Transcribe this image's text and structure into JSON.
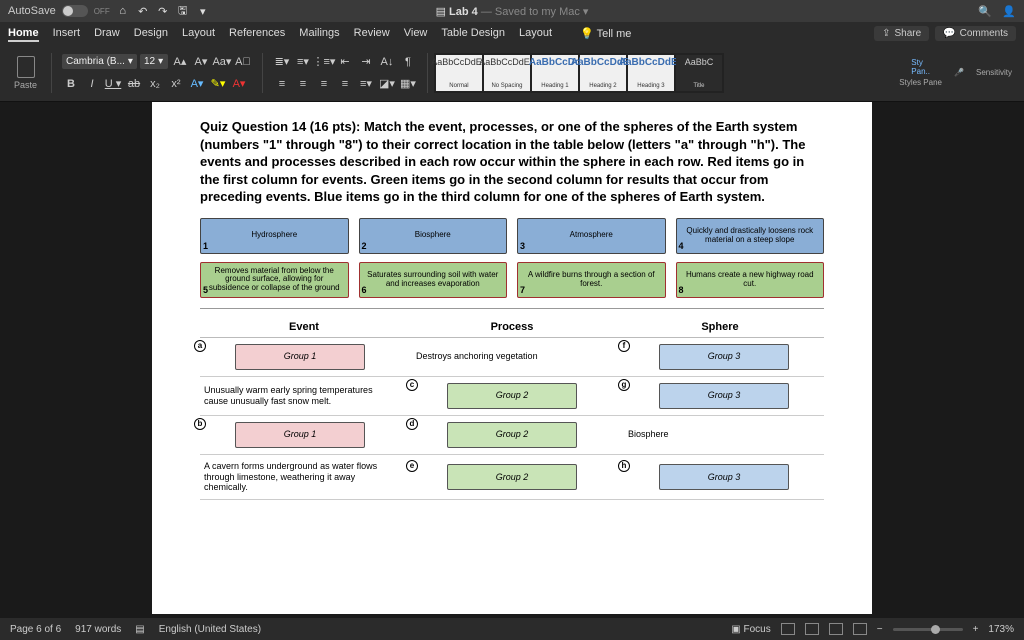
{
  "titlebar": {
    "autosave_label": "AutoSave",
    "autosave_state": "OFF",
    "doc_title": "Lab 4",
    "doc_status": "Saved to my Mac"
  },
  "menus": [
    "Home",
    "Insert",
    "Draw",
    "Design",
    "Layout",
    "References",
    "Mailings",
    "Review",
    "View",
    "Table Design",
    "Layout"
  ],
  "tellme": "Tell me",
  "share": "Share",
  "comments": "Comments",
  "ribbon": {
    "paste": "Paste",
    "font_name": "Cambria (B...",
    "font_size": "12",
    "styles": [
      {
        "preview": "AaBbCcDdEe",
        "name": "Normal"
      },
      {
        "preview": "AaBbCcDdEe",
        "name": "No Spacing"
      },
      {
        "preview": "AaBbCcDd",
        "name": "Heading 1",
        "blue": true
      },
      {
        "preview": "AaBbCcDdEe",
        "name": "Heading 2",
        "blue": true
      },
      {
        "preview": "AaBbCcDdEe",
        "name": "Heading 3",
        "blue": true
      },
      {
        "preview": "AaBbC",
        "name": "Title",
        "dark": true
      }
    ],
    "styles_pane": "Styles Pane",
    "sensitivity": "Sensitivity",
    "dictate": "Dictate"
  },
  "doc": {
    "heading_bold": "Quiz Question 14 (16 pts): ",
    "heading_rest": "Match the event, processes, or one of the spheres of the Earth system (numbers \"1\" through \"8\") to their correct location in the table below (letters \"a\" through \"h\"). The events and processes described in each row occur within the sphere in each row. Red items go in the first column for events. Green items go in the second column for results that occur from preceding events. Blue items go in the third column for one of the spheres of Earth system.",
    "cards_blue": [
      {
        "n": "1",
        "t": "Hydrosphere"
      },
      {
        "n": "2",
        "t": "Biosphere"
      },
      {
        "n": "3",
        "t": "Atmosphere"
      },
      {
        "n": "4",
        "t": "Quickly and drastically loosens rock material on a steep slope"
      }
    ],
    "cards_green": [
      {
        "n": "5",
        "t": "Removes material from below the ground surface, allowing for subsidence or collapse of the ground"
      },
      {
        "n": "6",
        "t": "Saturates surrounding soil with water and increases evaporation"
      },
      {
        "n": "7",
        "t": "A wildfire burns through a section of forest."
      },
      {
        "n": "8",
        "t": "Humans create a new highway road cut."
      }
    ],
    "th": [
      "Event",
      "Process",
      "Sphere"
    ],
    "rows": [
      {
        "a": "a",
        "at": "drop-pink",
        "av": "Group 1",
        "b": null,
        "bt": "text",
        "bv": "Destroys anchoring vegetation",
        "c": "f",
        "ct": "drop-blu",
        "cv": "Group 3"
      },
      {
        "a": null,
        "at": "text",
        "av": "Unusually warm early spring temperatures cause unusually fast snow melt.",
        "b": "c",
        "bt": "drop-grn",
        "bv": "Group 2",
        "c": "g",
        "ct": "drop-blu",
        "cv": "Group 3"
      },
      {
        "a": "b",
        "at": "drop-pink",
        "av": "Group 1",
        "b": "d",
        "bt": "drop-grn",
        "bv": "Group 2",
        "c": null,
        "ct": "text",
        "cv": "Biosphere"
      },
      {
        "a": null,
        "at": "text",
        "av": "A cavern forms underground as water flows through limestone, weathering it away chemically.",
        "b": "e",
        "bt": "drop-grn",
        "bv": "Group 2",
        "c": "h",
        "ct": "drop-blu",
        "cv": "Group 3"
      }
    ]
  },
  "status": {
    "page": "Page 6 of 6",
    "words": "917 words",
    "lang": "English (United States)",
    "focus": "Focus",
    "zoom": "173%"
  }
}
